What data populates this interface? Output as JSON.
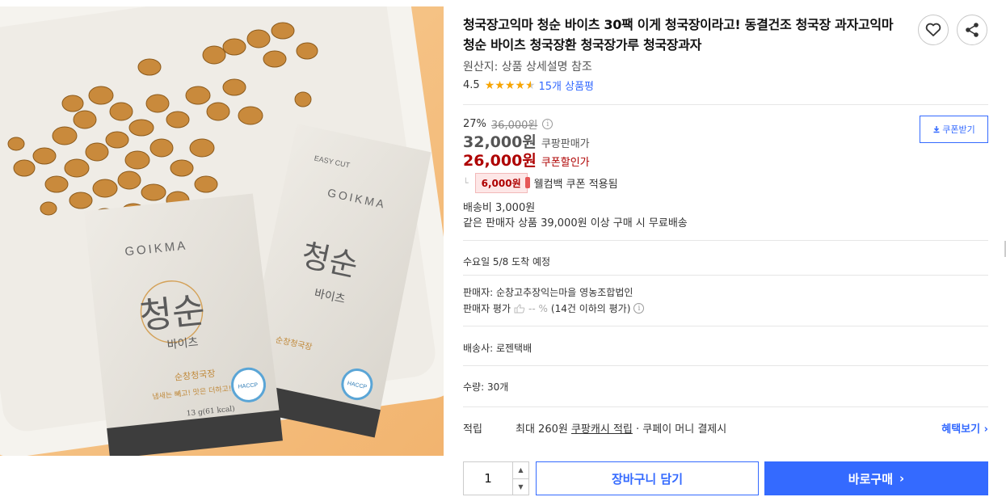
{
  "product": {
    "title": "청국장고익마 청순 바이츠 30팩 이게 청국장이라고! 동결건조 청국장 과자고익마 청순 바이츠 청국장환 청국장가루 청국장과자",
    "origin": "원산지: 상품 상세설명 참조",
    "rating": "4.5",
    "review_link": "15개 상품평",
    "image": {
      "brand": "GOIKMA",
      "pack_name": "청순",
      "pack_sub": "바이츠",
      "pack_line1": "순창청국장",
      "pack_line2": "냄새는 빼고! 맛은 더하고!",
      "pack_weight": "13 g(61 kcal)",
      "easy_cut": "EASY CUT",
      "haccp": "HACCP"
    }
  },
  "icons": {
    "heart": "heart-icon",
    "share": "share-icon",
    "info": "info-icon",
    "download": "download-icon",
    "thumb": "thumbs-up-icon"
  },
  "price": {
    "discount_rate": "27%",
    "original_price": "36,000원",
    "sale_price": "32,000원",
    "sale_label": "쿠팡판매가",
    "coupon_price": "26,000원",
    "coupon_label": "쿠폰할인가",
    "coupon_button": "쿠폰받기",
    "welcome_amount": "6,000원",
    "welcome_text": "웰컴백 쿠폰 적용됨"
  },
  "shipping": {
    "fee": "배송비 3,000원",
    "free_condition": "같은 판매자 상품 39,000원 이상 구매 시 무료배송",
    "arrival": "수요일 5/8 도착 예정",
    "carrier": "배송사: 로젠택배"
  },
  "seller": {
    "name": "판매자: 순창고추장익는마을 영농조합법인",
    "rating_label": "판매자 평가",
    "rating_value": "-- %",
    "rating_note": "(14건 이하의 평가)"
  },
  "quantity_info": "수량: 30개",
  "reward": {
    "label": "적립",
    "prefix": "최대 260원 ",
    "link": "쿠팡캐시 적립",
    "suffix": " · 쿠페이 머니 결제시",
    "benefit_link": "혜택보기 ›"
  },
  "purchase": {
    "quantity": "1",
    "cart_button": "장바구니 담기",
    "buy_button": "바로구매",
    "buy_arrow": "›"
  },
  "colors": {
    "accent": "#346aff",
    "coupon": "#ae0000",
    "star": "#f7a400"
  }
}
